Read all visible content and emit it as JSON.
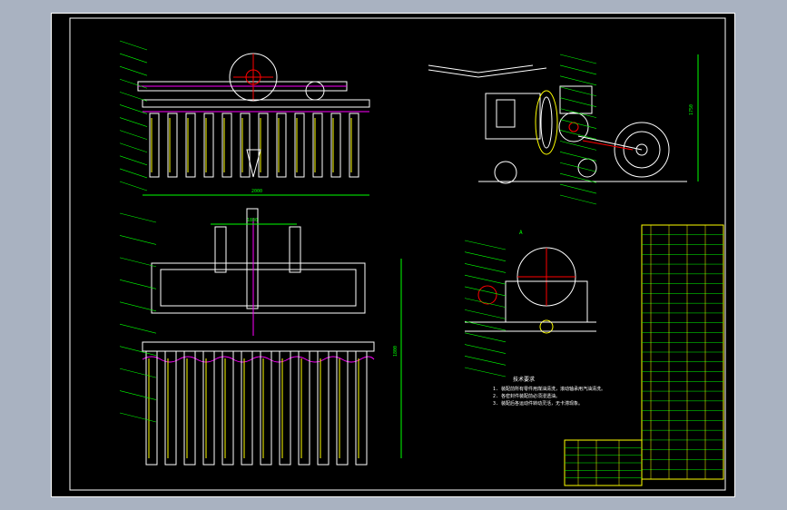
{
  "drawing": {
    "background": "#000000",
    "frame_color": "#ffffff",
    "line_colors": {
      "outline": "#ffffff",
      "leader": "#00ff00",
      "center": "#ff0000",
      "highlight": "#ffff00",
      "hatch": "#ff00ff",
      "dimension": "#00ffff"
    }
  },
  "views": {
    "front": {
      "dimension_text": "2000"
    },
    "top": {
      "dimension_text": "1800",
      "side_dimension_text": "1800"
    },
    "side": {
      "dimension_text": "1750"
    },
    "section": {
      "label": "A"
    }
  },
  "notes": {
    "title": "技术要求",
    "lines": [
      "1. 装配前所有零件用煤油清洗，滚动轴承用汽油清洗。",
      "2. 各密封件装配前必须浸透油。",
      "3. 装配后各运动件转动灵活，无卡滞现象。"
    ]
  },
  "title_block": {
    "rows": 6
  },
  "parts_list": {
    "rows": 26
  }
}
